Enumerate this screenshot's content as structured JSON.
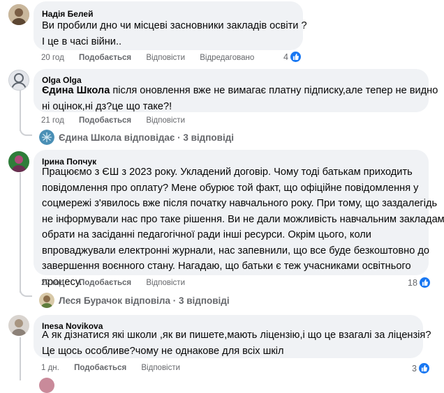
{
  "comments": [
    {
      "author": "Надія Белей",
      "lines": [
        "Ви пробили дно чи місцеві засновники закладів освіти ?",
        "І це в часі війни.."
      ],
      "time": "20 год",
      "like": "Подобається",
      "reply": "Відповісти",
      "edited": "Відредаговано",
      "reactions": "4"
    },
    {
      "author": "Olga Olga",
      "mention": "Єдина Школа",
      "line1_rest": " після оновлення вже не вимагає платну підписку,але тепер не видно",
      "line2": "ні оцінок,ні дз?це що таке?!",
      "time": "21 год",
      "like": "Подобається",
      "reply": "Відповісти",
      "replies_summary": "Єдина Школа відповідає · 3 відповіді"
    },
    {
      "author": "Ірина Попчук",
      "lines": [
        "Працюємо з ЄШ з 2023 року. Укладений договір. Чому тоді батькам приходить",
        "повідомлення про оплату? Мене обурює той факт, що офіційне повідомлення у",
        "соцмережі з'явилось вже після початку навчального року. При тому, що заздалегідь",
        "не інформували нас про таке рішення. Ви не дали можливість навчальним закладам",
        "обрати на засіданні педагогічної ради інші ресурси. Окрім цього, коли",
        "впроваджували електронні журнали, нас запевнили, що все буде безкоштовно до",
        "завершення воєнного стану. Нагадаю, що батьки є теж учасниками освітнього",
        "процесу."
      ],
      "time": "22 год",
      "like": "Подобається",
      "reply": "Відповісти",
      "reactions": "18",
      "replies_summary": "Леся Бурачок відповіла · 3 відповіді"
    },
    {
      "author": "Inesa Novikova",
      "lines": [
        "А як дізнатися які школи ,як ви пишете,мають ліцензію,і що це взагалі за ліцензія?",
        "Це щось особливе?чому не однакове для всіх шкіл"
      ],
      "time": "1 дн.",
      "like": "Подобається",
      "reply": "Відповісти",
      "reactions": "3"
    }
  ],
  "colors": {
    "bubble": "#f0f2f5",
    "meta": "#65676b",
    "like_blue": "#1877f2",
    "thread": "#ced0d4"
  }
}
